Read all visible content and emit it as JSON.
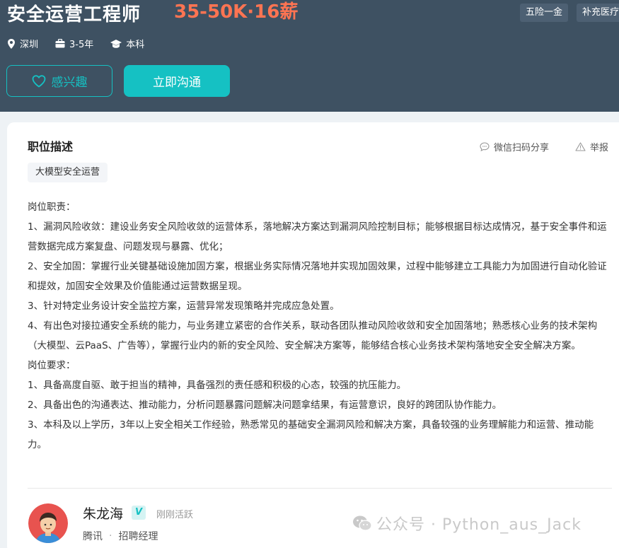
{
  "header": {
    "title": "安全运营工程师",
    "salary": "35-50K·16薪",
    "welfare": [
      "五险一金",
      "补充医疗"
    ],
    "meta": {
      "city": "深圳",
      "experience": "3-5年",
      "degree": "本科"
    },
    "buttons": {
      "interest": "感兴趣",
      "chat": "立即沟通"
    }
  },
  "card": {
    "section_title": "职位描述",
    "share_label": "微信扫码分享",
    "report_label": "举报",
    "tag": "大模型安全运营",
    "description": [
      "岗位职责：",
      "1、漏洞风险收敛：建设业务安全风险收敛的运营体系，落地解决方案达到漏洞风险控制目标；能够根据目标达成情况，基于安全事件和运营数据完成方案复盘、问题发现与暴露、优化；",
      "2、安全加固：掌握行业关键基础设施加固方案，根据业务实际情况落地并实现加固效果，过程中能够建立工具能力为加固进行自动化验证和提效，加固安全效果及价值能通过运营数据呈现。",
      "3、针对特定业务设计安全监控方案，运营异常发现策略并完成应急处置。",
      "4、有出色对接拉通安全系统的能力，与业务建立紧密的合作关系，联动各团队推动风险收敛和安全加固落地；熟悉核心业务的技术架构（大模型、云PaaS、广告等），掌握行业内的新的安全风险、安全解决方案等，能够结合核心业务技术架构落地安全安全解决方案。",
      "岗位要求：",
      "1、具备高度自驱、敢于担当的精神，具备强烈的责任感和积极的心态，较强的抗压能力。",
      "2、具备出色的沟通表达、推动能力，分析问题暴露问题解决问题拿结果，有运营意识，良好的跨团队协作能力。",
      "3、本科及以上学历，3年以上安全相关工作经验，熟悉常见的基础安全漏洞风险和解决方案，具备较强的业务理解能力和运营、推动能力。"
    ]
  },
  "recruiter": {
    "name": "朱龙海",
    "verified_mark": "V",
    "status": "刚刚活跃",
    "company": "腾讯",
    "separator": "·",
    "role": "招聘经理"
  },
  "watermark": "公众号 · Python_aus_Jack",
  "colors": {
    "header_bg": "#3e5162",
    "accent": "#15c1c3",
    "salary": "#ff7452"
  }
}
